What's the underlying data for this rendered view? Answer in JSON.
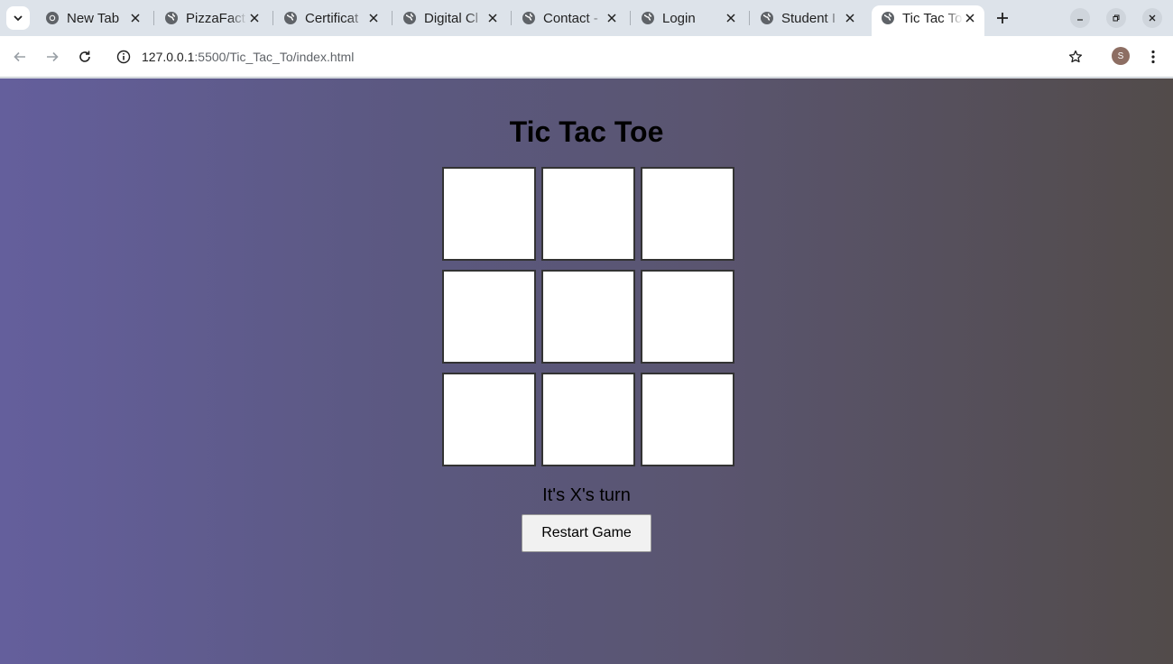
{
  "browser": {
    "tabs": [
      {
        "title": "New Tab",
        "favicon": "chrome-icon",
        "active": false
      },
      {
        "title": "PizzaFact",
        "favicon": "globe-icon",
        "active": false
      },
      {
        "title": "Certificat",
        "favicon": "globe-icon",
        "active": false
      },
      {
        "title": "Digital Cl",
        "favicon": "globe-icon",
        "active": false
      },
      {
        "title": "Contact -",
        "favicon": "globe-icon",
        "active": false
      },
      {
        "title": "Login",
        "favicon": "globe-icon",
        "active": false
      },
      {
        "title": "Student I",
        "favicon": "globe-icon",
        "active": false
      },
      {
        "title": "Tic Tac To",
        "favicon": "globe-icon",
        "active": true
      }
    ],
    "url_host": "127.0.0.1",
    "url_path": ":5500/Tic_Tac_To/index.html",
    "profile_initial": "S"
  },
  "game": {
    "title": "Tic Tac Toe",
    "cells": [
      "",
      "",
      "",
      "",
      "",
      "",
      "",
      "",
      ""
    ],
    "status": "It's X's turn",
    "restart_label": "Restart Game"
  },
  "colors": {
    "gradient_left": "#645f9c",
    "gradient_right": "#524b4a",
    "cell_background": "#ffffff",
    "cell_border": "#333333"
  }
}
